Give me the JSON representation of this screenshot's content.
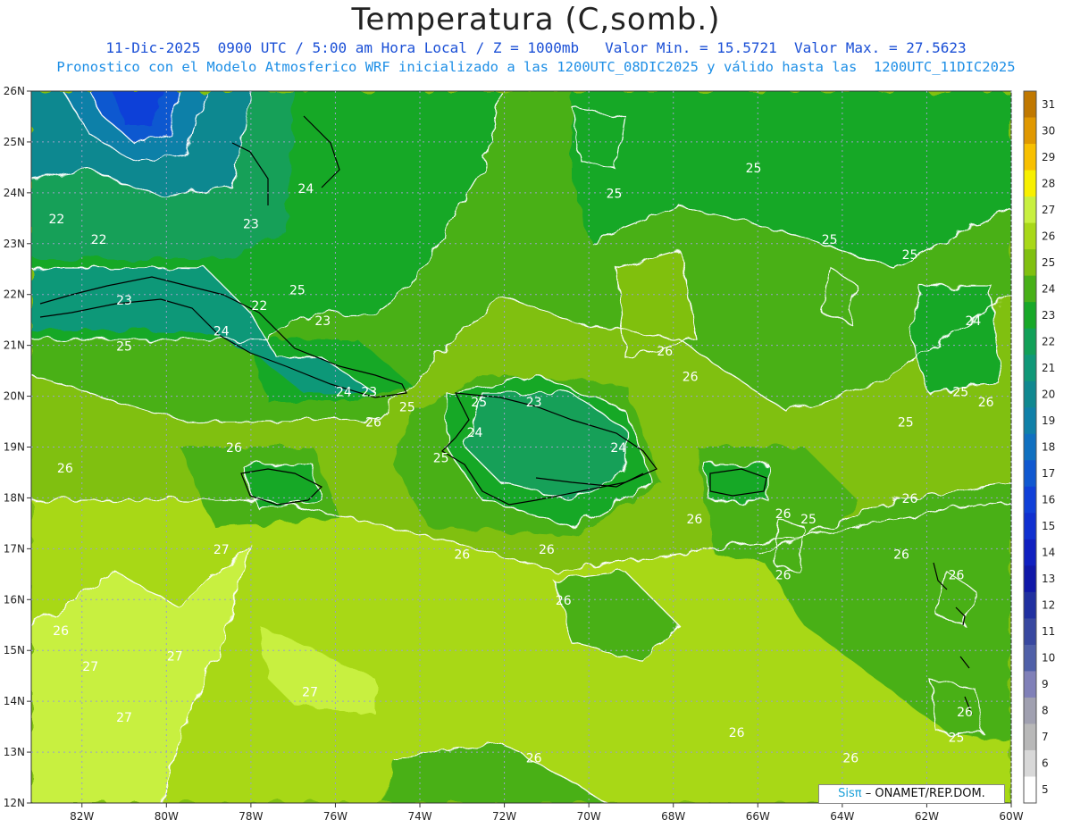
{
  "title": "Temperatura (C,somb.)",
  "subtitle_1": "11-Dic-2025  0900 UTC / 5:00 am Hora Local / Z = 1000mb   Valor Min. = 15.5721  Valor Max. = 27.5623",
  "subtitle_2": "Pronostico con el Modelo Atmosferico WRF inicializado a las 1200UTC_08DIC2025 y válido hasta las  1200UTC_11DIC2025",
  "credit": {
    "brand": "Sisπ",
    "text": "– ONAMET/REP.DOM."
  },
  "map": {
    "lon_range": [
      -83.2,
      -60
    ],
    "lat_range": [
      12,
      26
    ],
    "lon_ticks": [
      "82W",
      "80W",
      "78W",
      "76W",
      "74W",
      "72W",
      "70W",
      "68W",
      "66W",
      "64W",
      "62W",
      "60W"
    ],
    "lat_ticks": [
      "26N",
      "25N",
      "24N",
      "23N",
      "22N",
      "21N",
      "20N",
      "19N",
      "18N",
      "17N",
      "16N",
      "15N",
      "14N",
      "13N",
      "12N"
    ],
    "contour_labels": [
      {
        "text": "24",
        "lon": -76.7,
        "lat": 24.0
      },
      {
        "text": "23",
        "lon": -78.0,
        "lat": 23.3
      },
      {
        "text": "22",
        "lon": -82.6,
        "lat": 23.4
      },
      {
        "text": "22",
        "lon": -81.6,
        "lat": 23.0
      },
      {
        "text": "25",
        "lon": -76.9,
        "lat": 22.0
      },
      {
        "text": "23",
        "lon": -81.0,
        "lat": 21.8
      },
      {
        "text": "22",
        "lon": -77.8,
        "lat": 21.7
      },
      {
        "text": "23",
        "lon": -76.3,
        "lat": 21.4
      },
      {
        "text": "24",
        "lon": -78.7,
        "lat": 21.2
      },
      {
        "text": "25",
        "lon": -81.0,
        "lat": 20.9
      },
      {
        "text": "24",
        "lon": -75.8,
        "lat": 20.0
      },
      {
        "text": "23",
        "lon": -75.2,
        "lat": 20.0
      },
      {
        "text": "25",
        "lon": -74.3,
        "lat": 19.7
      },
      {
        "text": "26",
        "lon": -75.1,
        "lat": 19.4
      },
      {
        "text": "26",
        "lon": -78.4,
        "lat": 18.9
      },
      {
        "text": "26",
        "lon": -82.4,
        "lat": 18.5
      },
      {
        "text": "25",
        "lon": -72.6,
        "lat": 19.8
      },
      {
        "text": "23",
        "lon": -71.3,
        "lat": 19.8
      },
      {
        "text": "24",
        "lon": -72.7,
        "lat": 19.2
      },
      {
        "text": "24",
        "lon": -69.3,
        "lat": 18.9
      },
      {
        "text": "25",
        "lon": -73.5,
        "lat": 18.7
      },
      {
        "text": "26",
        "lon": -73.0,
        "lat": 16.8
      },
      {
        "text": "26",
        "lon": -71.0,
        "lat": 16.9
      },
      {
        "text": "26",
        "lon": -67.5,
        "lat": 17.5
      },
      {
        "text": "26",
        "lon": -65.4,
        "lat": 17.6
      },
      {
        "text": "25",
        "lon": -64.8,
        "lat": 17.5
      },
      {
        "text": "26",
        "lon": -62.4,
        "lat": 17.9
      },
      {
        "text": "26",
        "lon": -62.6,
        "lat": 16.8
      },
      {
        "text": "26",
        "lon": -65.4,
        "lat": 16.4
      },
      {
        "text": "26",
        "lon": -61.3,
        "lat": 16.4
      },
      {
        "text": "26",
        "lon": -70.6,
        "lat": 15.9
      },
      {
        "text": "26",
        "lon": -82.5,
        "lat": 15.3
      },
      {
        "text": "27",
        "lon": -78.7,
        "lat": 16.9
      },
      {
        "text": "27",
        "lon": -81.8,
        "lat": 14.6
      },
      {
        "text": "27",
        "lon": -79.8,
        "lat": 14.8
      },
      {
        "text": "27",
        "lon": -81.0,
        "lat": 13.6
      },
      {
        "text": "27",
        "lon": -76.6,
        "lat": 14.1
      },
      {
        "text": "26",
        "lon": -71.3,
        "lat": 12.8
      },
      {
        "text": "26",
        "lon": -66.5,
        "lat": 13.3
      },
      {
        "text": "26",
        "lon": -63.8,
        "lat": 12.8
      },
      {
        "text": "26",
        "lon": -61.1,
        "lat": 13.7
      },
      {
        "text": "25",
        "lon": -61.3,
        "lat": 13.2
      },
      {
        "text": "26",
        "lon": -68.2,
        "lat": 20.8
      },
      {
        "text": "26",
        "lon": -67.6,
        "lat": 20.3
      },
      {
        "text": "25",
        "lon": -69.4,
        "lat": 23.9
      },
      {
        "text": "25",
        "lon": -66.1,
        "lat": 24.4
      },
      {
        "text": "25",
        "lon": -64.3,
        "lat": 23.0
      },
      {
        "text": "25",
        "lon": -62.4,
        "lat": 22.7
      },
      {
        "text": "24",
        "lon": -60.9,
        "lat": 21.4
      },
      {
        "text": "25",
        "lon": -62.5,
        "lat": 19.4
      },
      {
        "text": "25",
        "lon": -61.2,
        "lat": 20.0
      },
      {
        "text": "26",
        "lon": -60.6,
        "lat": 19.8
      }
    ]
  },
  "colorbar": {
    "labels": [
      "31",
      "30",
      "29",
      "28",
      "27",
      "26",
      "25",
      "24",
      "23",
      "22",
      "21",
      "20",
      "19",
      "18",
      "17",
      "16",
      "15",
      "14",
      "13",
      "12",
      "11",
      "10",
      "9",
      "8",
      "7",
      "6",
      "5"
    ],
    "colors": [
      "#c07800",
      "#e09800",
      "#f8c000",
      "#f8f000",
      "#c8f040",
      "#a8d818",
      "#80c010",
      "#48b018",
      "#18a828",
      "#12a058",
      "#109878",
      "#108890",
      "#1080a8",
      "#1070c0",
      "#1058d0",
      "#1040d8",
      "#1030d0",
      "#1020c0",
      "#1018a8",
      "#2030a0",
      "#3848a0",
      "#5060a8",
      "#8080b8",
      "#a0a0b0",
      "#b8b8b8",
      "#d8d8d8",
      "#ffffff"
    ]
  }
}
